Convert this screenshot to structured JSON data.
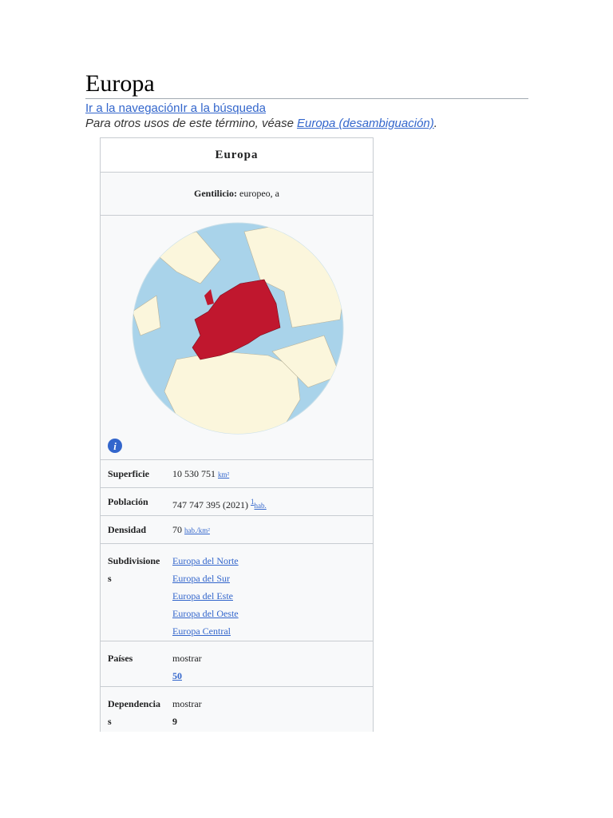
{
  "title": "Europa",
  "skip_links": "Ir a la navegaciónIr a la búsqueda",
  "hatnote": {
    "text": "Para otros usos de este término, véase",
    "link": "Europa (desambiguación)",
    "end": "."
  },
  "infobox": {
    "header": "Europa",
    "gentilicio_label": "Gentilicio:",
    "gentilicio_value": "europeo, a",
    "rows": {
      "superficie": {
        "label": "Superficie",
        "value": "10 530 751",
        "unit": "km²"
      },
      "poblacion": {
        "label": "Población",
        "value": "747 747 395 (2021)",
        "ref": "1",
        "unit": "hab."
      },
      "densidad": {
        "label": "Densidad",
        "value": "70",
        "unit": "hab./km²"
      },
      "subdivisiones": {
        "label": "Subdivisiones",
        "items": [
          "Europa del Norte",
          "Europa del Sur",
          "Europa del Este",
          "Europa del Oeste",
          "Europa Central"
        ]
      },
      "paises": {
        "label": "Países",
        "toggle": "mostrar",
        "count": "50"
      },
      "dependencias": {
        "label": "Dependencias",
        "toggle": "mostrar",
        "count": "9"
      }
    }
  },
  "colors": {
    "link": "#3366cc",
    "europe": "#c0172e",
    "ocean": "#a9d3ea",
    "land": "#fbf6dc"
  }
}
